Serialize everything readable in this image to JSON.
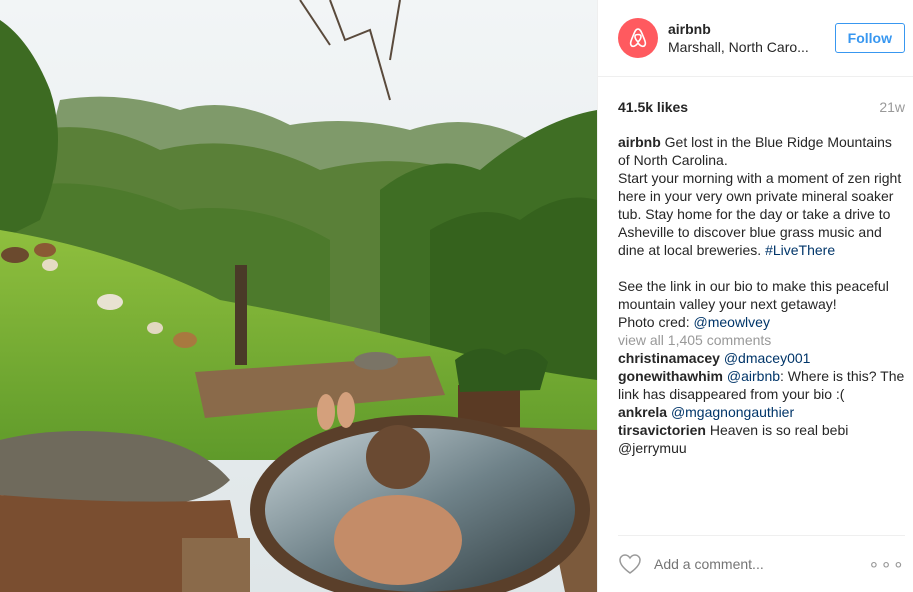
{
  "photo": {
    "alt": ""
  },
  "header": {
    "username": "airbnb",
    "location": "Marshall, North Caro...",
    "follow_label": "Follow"
  },
  "meta": {
    "likes": "41.5k likes",
    "age": "21w"
  },
  "caption": {
    "user": "airbnb",
    "text": "Get lost in the Blue Ridge Mountains of North Carolina.\nStart your morning with a moment of zen right here in your very own private mineral soaker tub. Stay home for the day or take a drive to Asheville to discover blue grass music and dine at local breweries. ",
    "hashtag": "#LiveThere",
    "text2": "\n\nSee the link in our bio to make this peaceful mountain valley your next getaway!\nPhoto cred: ",
    "mention": "@meowlvey"
  },
  "view_all": "view all 1,405 comments",
  "comments": [
    {
      "user": "christinamacey",
      "mention": "@dmacey001",
      "text": ""
    },
    {
      "user": "gonewithawhim",
      "mention": "@airbnb",
      "text": ": Where is this? The link has disappeared from your bio :("
    },
    {
      "user": "ankrela",
      "mention": "@mgagnongauthier",
      "text": ""
    },
    {
      "user": "tirsavictorien",
      "mention": "",
      "text": "Heaven is so real bebi @jerrymuu"
    }
  ],
  "add_comment": {
    "placeholder": "Add a comment..."
  },
  "icons": {
    "like": "heart-icon",
    "more": "more-options-icon",
    "brand": "airbnb-logo-icon"
  },
  "colors": {
    "brand": "#ff5a5f",
    "link": "#3897f0"
  }
}
